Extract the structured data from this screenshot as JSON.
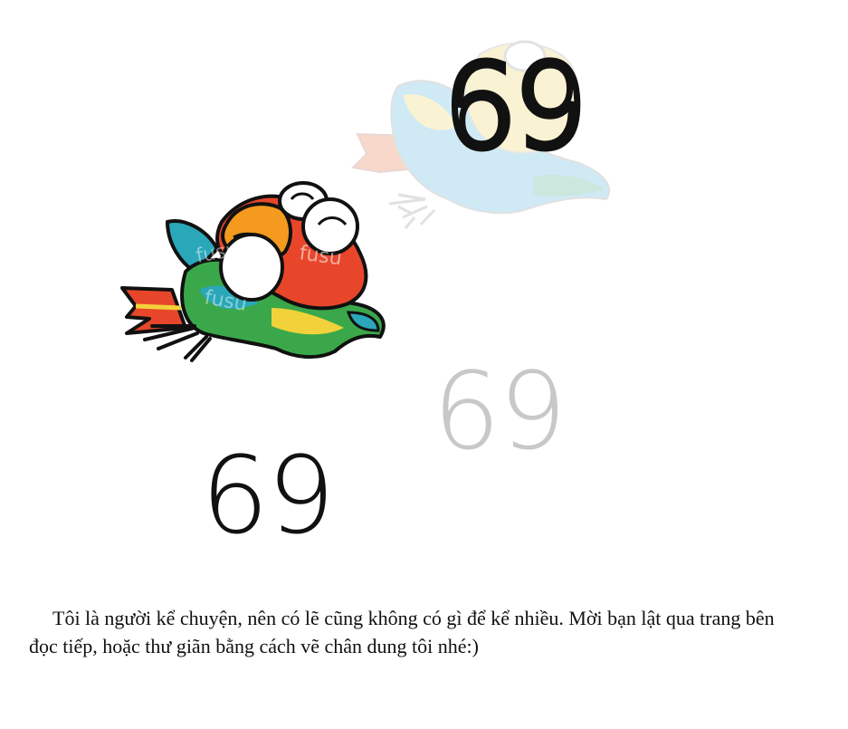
{
  "illustration": {
    "numerals": {
      "top_right": "69",
      "middle_faded": "69",
      "bottom_left": "69"
    },
    "watermark": "fusu",
    "colors": {
      "outline": "#111111",
      "faded_numeral": "#c8c8c8",
      "beak_orange": "#f39a1f",
      "body_red": "#e8462a",
      "wing_green": "#3aa84a",
      "wing_teal": "#2aa7b8",
      "wing_yellow": "#f2d23a",
      "ghost_blue": "#a9d8ee",
      "ghost_yellow": "#f6eab0"
    }
  },
  "text": {
    "paragraph": "Tôi là người kể chuyện, nên có lẽ cũng không có gì để kể nhiều. Mời bạn lật qua trang bên đọc tiếp, hoặc thư giãn bằng cách vẽ chân dung tôi nhé:)"
  }
}
